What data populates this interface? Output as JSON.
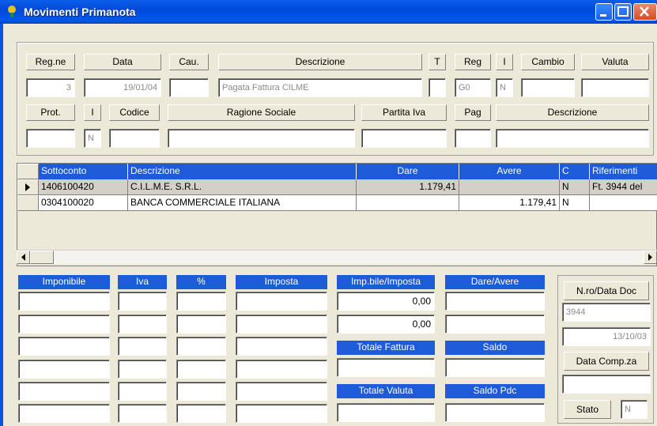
{
  "window": {
    "title": "Movimenti Primanota"
  },
  "header": {
    "labels_row1": [
      "Reg.ne",
      "Data",
      "Cau.",
      "Descrizione",
      "T",
      "Reg",
      "I",
      "Cambio",
      "Valuta"
    ],
    "values_row1": {
      "regne": "3",
      "data": "19/01/04",
      "cau": "",
      "descrizione": "Pagata Fattura CILME",
      "t": "",
      "reg": "G0",
      "i": "N",
      "cambio": "",
      "valuta": ""
    },
    "labels_row2": [
      "Prot.",
      "I",
      "Codice",
      "Ragione Sociale",
      "Partita Iva",
      "Pag",
      "Descrizione"
    ],
    "values_row2": {
      "prot": "",
      "i": "N",
      "codice": "",
      "ragione": "",
      "piva": "",
      "pag": "",
      "descrizione": ""
    }
  },
  "grid": {
    "columns": [
      "Sottoconto",
      "Descrizione",
      "Dare",
      "Avere",
      "C",
      "Riferimenti"
    ],
    "rows": [
      {
        "sottoconto": "1406100420",
        "descrizione": "C.I.L.M.E. S.R.L.",
        "dare": "1.179,41",
        "avere": "",
        "c": "N",
        "riferimenti": "Ft. 3944 del"
      },
      {
        "sottoconto": "0304100020",
        "descrizione": "BANCA COMMERCIALE ITALIANA",
        "dare": "",
        "avere": "1.179,41",
        "c": "N",
        "riferimenti": ""
      }
    ]
  },
  "vat": {
    "headers": [
      "Imponibile",
      "Iva",
      "%",
      "Imposta"
    ]
  },
  "totals": {
    "imp_header": "Imp.bile/Imposta",
    "da_header": "Dare/Avere",
    "imp_values": [
      "0,00",
      "0,00"
    ],
    "totale_fattura": "Totale Fattura",
    "saldo": "Saldo",
    "totale_valuta": "Totale Valuta",
    "saldo_pdc": "Saldo Pdc"
  },
  "doc": {
    "nro_label": "N.ro/Data Doc",
    "numero": "3944",
    "data": "13/10/03",
    "comp_label": "Data Comp.za",
    "stato_label": "Stato",
    "stato": "N"
  }
}
